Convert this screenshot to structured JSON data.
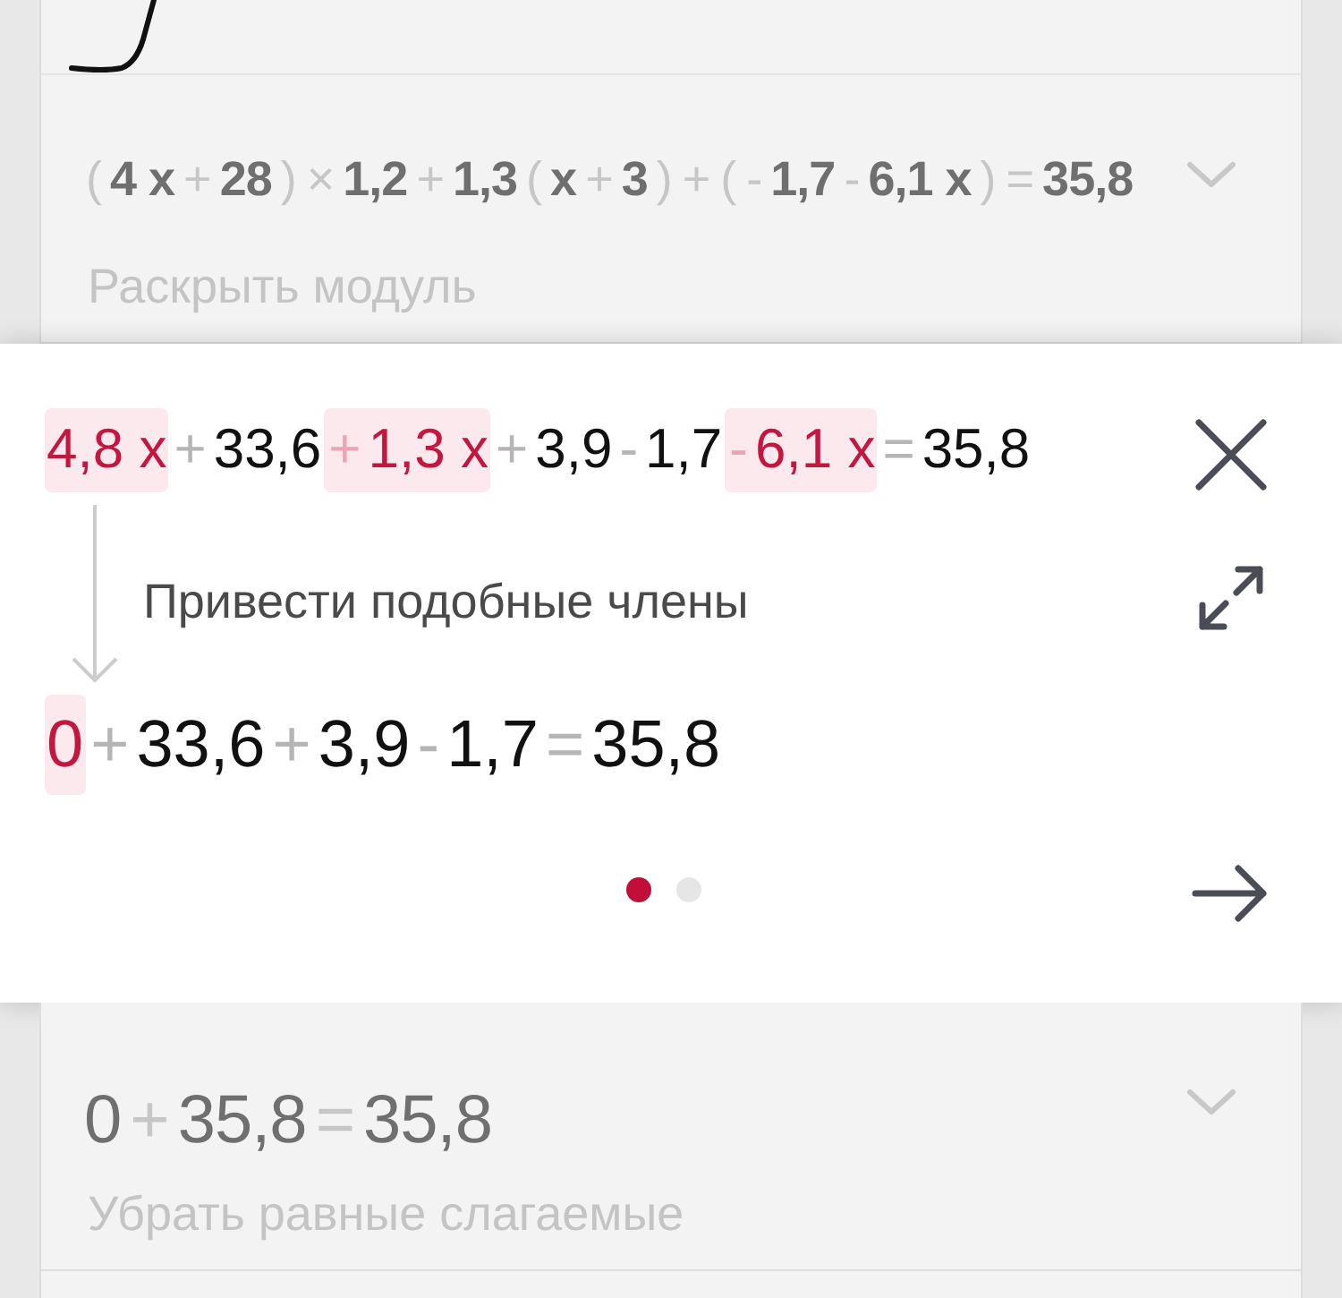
{
  "steps_before": [
    {
      "description": "Раскрыть модуль",
      "equation": [
        {
          "kind": "op",
          "text": "("
        },
        {
          "kind": "term",
          "text": "4 x"
        },
        {
          "kind": "op",
          "text": "+"
        },
        {
          "kind": "term",
          "text": "28"
        },
        {
          "kind": "op",
          "text": ")"
        },
        {
          "kind": "op",
          "text": "×"
        },
        {
          "kind": "term",
          "text": "1,2"
        },
        {
          "kind": "op",
          "text": "+"
        },
        {
          "kind": "term",
          "text": "1,3"
        },
        {
          "kind": "op",
          "text": "("
        },
        {
          "kind": "term",
          "text": "x"
        },
        {
          "kind": "op",
          "text": "+"
        },
        {
          "kind": "term",
          "text": "3"
        },
        {
          "kind": "op",
          "text": ")"
        },
        {
          "kind": "op",
          "text": "+"
        },
        {
          "kind": "op",
          "text": "("
        },
        {
          "kind": "op",
          "text": "-"
        },
        {
          "kind": "term",
          "text": "1,7"
        },
        {
          "kind": "op",
          "text": "-"
        },
        {
          "kind": "term",
          "text": "6,1 x"
        },
        {
          "kind": "op",
          "text": ")"
        },
        {
          "kind": "op",
          "text": "="
        },
        {
          "kind": "term",
          "text": "35,8"
        }
      ]
    }
  ],
  "popup": {
    "description": "Привести подобные члены",
    "equation": [
      {
        "kind": "term",
        "text": "4,8 x",
        "highlighted": true
      },
      {
        "kind": "op",
        "text": "+",
        "highlighted": false
      },
      {
        "kind": "term",
        "text": "33,6",
        "highlighted": false
      },
      {
        "kind": "op",
        "text": "+",
        "highlighted": true
      },
      {
        "kind": "term",
        "text": "1,3 x",
        "highlighted": true
      },
      {
        "kind": "op",
        "text": "+",
        "highlighted": false
      },
      {
        "kind": "term",
        "text": "3,9",
        "highlighted": false
      },
      {
        "kind": "op",
        "text": "-",
        "highlighted": false
      },
      {
        "kind": "term",
        "text": "1,7",
        "highlighted": false
      },
      {
        "kind": "op",
        "text": "-",
        "highlighted": true
      },
      {
        "kind": "term",
        "text": "6,1 x",
        "highlighted": true
      },
      {
        "kind": "op",
        "text": "=",
        "highlighted": false
      },
      {
        "kind": "term",
        "text": "35,8",
        "highlighted": false
      }
    ],
    "result": [
      {
        "kind": "term",
        "text": "0",
        "highlighted": true
      },
      {
        "kind": "op",
        "text": "+",
        "highlighted": false
      },
      {
        "kind": "term",
        "text": "33,6",
        "highlighted": false
      },
      {
        "kind": "op",
        "text": "+",
        "highlighted": false
      },
      {
        "kind": "term",
        "text": "3,9",
        "highlighted": false
      },
      {
        "kind": "op",
        "text": "-",
        "highlighted": false
      },
      {
        "kind": "term",
        "text": "1,7",
        "highlighted": false
      },
      {
        "kind": "op",
        "text": "=",
        "highlighted": false
      },
      {
        "kind": "term",
        "text": "35,8",
        "highlighted": false
      }
    ],
    "pages": [
      {
        "selected": true
      },
      {
        "selected": false
      }
    ]
  },
  "steps_after": [
    {
      "description": "Убрать равные слагаемые",
      "equation": [
        {
          "kind": "term",
          "text": "0"
        },
        {
          "kind": "op",
          "text": "+"
        },
        {
          "kind": "term",
          "text": "35,8"
        },
        {
          "kind": "op",
          "text": "="
        },
        {
          "kind": "term",
          "text": "35,8"
        }
      ]
    }
  ]
}
